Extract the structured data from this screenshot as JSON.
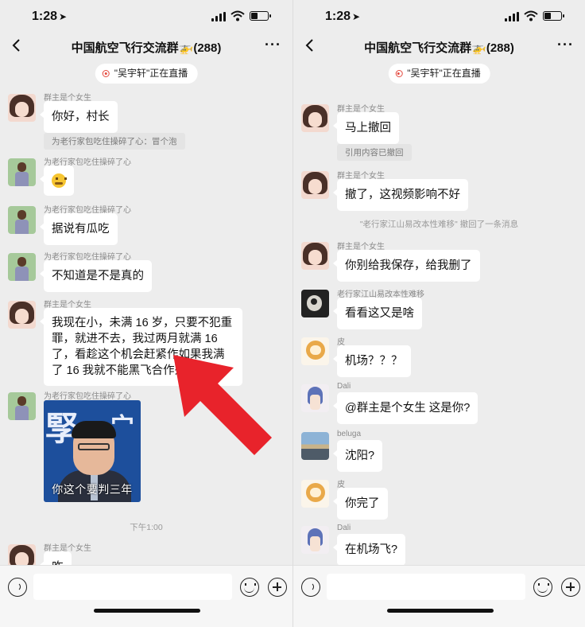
{
  "status_bar": {
    "time": "1:28",
    "location_icon": "location-arrow-icon"
  },
  "group": {
    "title": "中国航空飞行交流群🚁(288)",
    "more_label": "···"
  },
  "live_banner": {
    "text": "\"吴宇轩\"正在直播"
  },
  "left_chat": {
    "m1": {
      "sender": "群主是个女生",
      "text": "你好，村长"
    },
    "quote1": "为老行家包吃住操碎了心：冒个泡",
    "m2": {
      "sender": "为老行家包吃住操碎了心",
      "emoji": "grimace-emoji"
    },
    "m3": {
      "sender": "为老行家包吃住操碎了心",
      "text": "据说有瓜吃"
    },
    "m4": {
      "sender": "为老行家包吃住操碎了心",
      "text": "不知道是不是真的"
    },
    "m5": {
      "sender": "群主是个女生",
      "text": "我现在小，未满 16 岁，只要不犯重罪，就进不去，我过两月就满 16 了，看趁这个机会赶紧作如果我满了 16 我就不能黑飞合作死了"
    },
    "m6": {
      "sender": "为老行家包吃住操碎了心",
      "meme_caption": "你这个要判三年"
    },
    "time_divider": "下午1:00",
    "m7": {
      "sender": "群主是个女生",
      "text": "咋"
    }
  },
  "right_chat": {
    "m1": {
      "sender": "群主是个女生",
      "text": "马上撤回"
    },
    "quote1": "引用内容已撤回",
    "m2": {
      "sender": "群主是个女生",
      "text": "撤了，这视频影响不好"
    },
    "system": "\"老行家江山易改本性难移\" 撤回了一条消息",
    "m3": {
      "sender": "群主是个女生",
      "text": "你别给我保存，给我删了"
    },
    "m4": {
      "sender": "老行家江山易改本性难移",
      "text": "看看这又是啥"
    },
    "m5": {
      "sender": "皮",
      "text": "机场？？？"
    },
    "m6": {
      "sender": "Dali",
      "text": "@群主是个女生 这是你?"
    },
    "m7": {
      "sender": "beluga",
      "text": "沈阳?"
    },
    "m8": {
      "sender": "皮",
      "text": "你完了"
    },
    "m9": {
      "sender": "Dali",
      "text": "在机场飞?"
    }
  },
  "colors": {
    "background": "#ededed",
    "bubble": "#ffffff",
    "arrow": "#e8232b",
    "live_dot": "#e4483d"
  }
}
